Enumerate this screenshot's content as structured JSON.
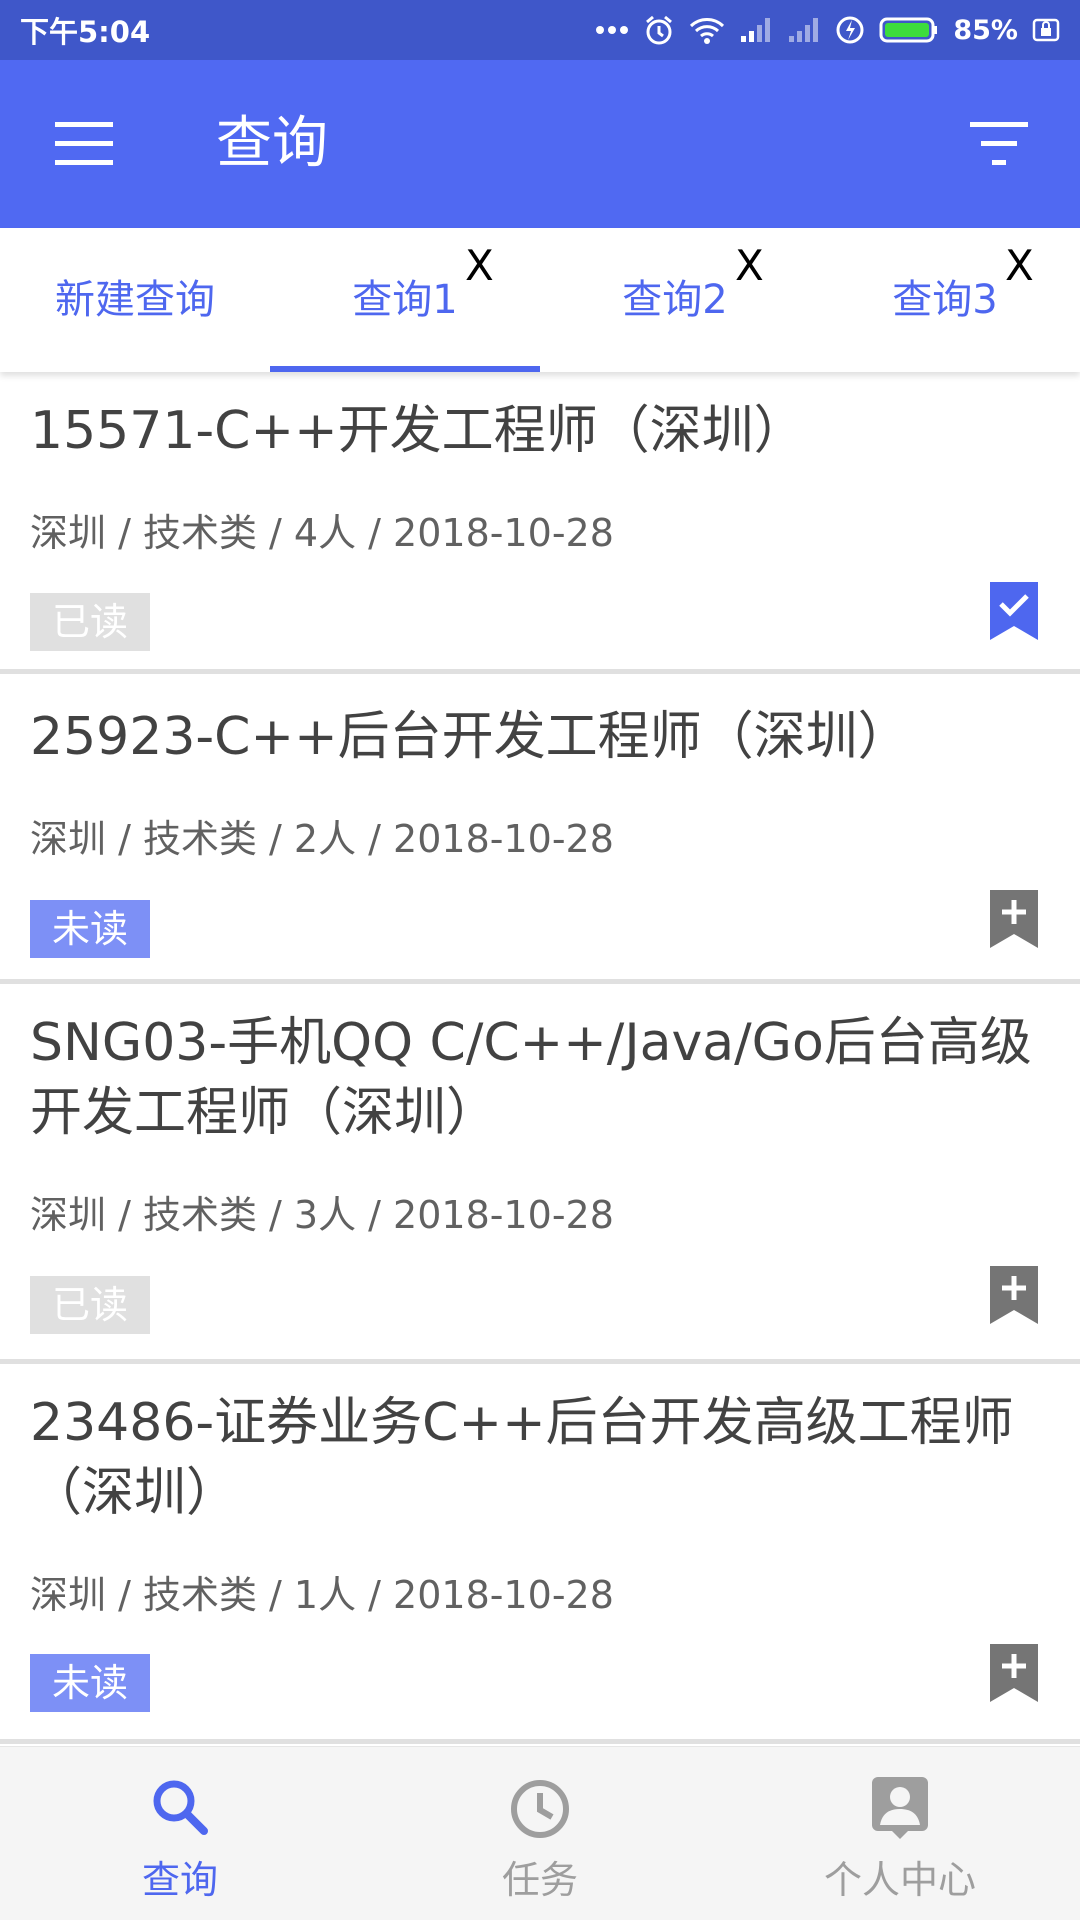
{
  "status_bar": {
    "time": "下午5:04",
    "battery": "85%"
  },
  "app_bar": {
    "title": "查询",
    "menu_icon": "hamburger-menu-icon",
    "filter_icon": "filter-icon"
  },
  "tabs": [
    {
      "label": "新建查询",
      "closable": false
    },
    {
      "label": "查询1",
      "closable": true,
      "active": true
    },
    {
      "label": "查询2",
      "closable": true
    },
    {
      "label": "查询3",
      "closable": true
    }
  ],
  "tab_close_label": "X",
  "jobs": [
    {
      "title": "15571-C++开发工程师（深圳）",
      "meta": "深圳 / 技术类 / 4人 / 2018-10-28",
      "status": "已读",
      "bookmarked": true
    },
    {
      "title": "25923-C++后台开发工程师（深圳）",
      "meta": "深圳 / 技术类 / 2人 / 2018-10-28",
      "status": "未读",
      "bookmarked": false
    },
    {
      "title": "SNG03-手机QQ C/C++/Java/Go后台高级开发工程师（深圳）",
      "meta": "深圳 / 技术类 / 3人 / 2018-10-28",
      "status": "已读",
      "bookmarked": false
    },
    {
      "title": "23486-证券业务C++后台开发高级工程师（深圳）",
      "meta": "深圳 / 技术类 / 1人 / 2018-10-28",
      "status": "未读",
      "bookmarked": false
    }
  ],
  "bottom_nav": [
    {
      "label": "查询",
      "icon": "search-icon",
      "active": true
    },
    {
      "label": "任务",
      "icon": "clock-icon",
      "active": false
    },
    {
      "label": "个人中心",
      "icon": "person-icon",
      "active": false
    }
  ],
  "colors": {
    "status_bar": "#3f57c9",
    "primary": "#5069f2",
    "accent": "#4e67ef",
    "unread_badge": "#7d90f6",
    "read_badge": "#e0e0e0",
    "inactive_nav": "#9e9e9e"
  }
}
